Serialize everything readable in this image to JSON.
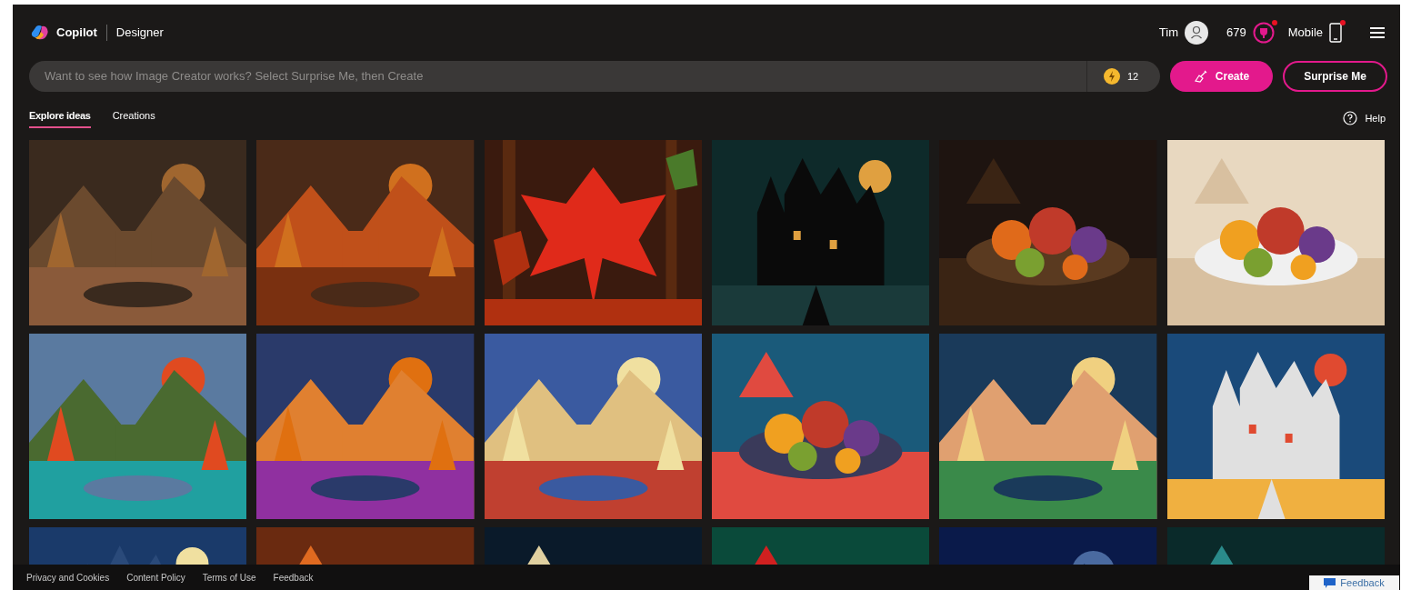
{
  "header": {
    "brand": "Copilot",
    "product": "Designer",
    "user": "Tim",
    "points": "679",
    "points_alert": true,
    "mobile": "Mobile",
    "mobile_alert": true
  },
  "prompt": {
    "placeholder": "Want to see how Image Creator works? Select Surprise Me, then Create",
    "boosts": "12"
  },
  "buttons": {
    "create": "Create",
    "surprise": "Surprise Me"
  },
  "tabs": [
    {
      "label": "Explore ideas",
      "selected": true
    },
    {
      "label": "Creations",
      "selected": false
    }
  ],
  "help": "Help",
  "footer": {
    "links": [
      "Privacy and Cookies",
      "Content Policy",
      "Terms of Use",
      "Feedback"
    ]
  },
  "feedback_button": "Feedback"
}
